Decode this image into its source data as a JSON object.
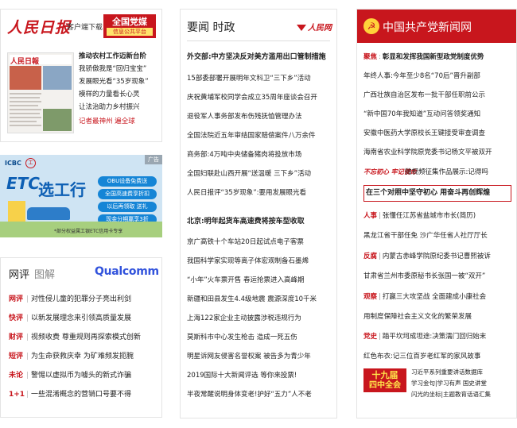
{
  "col1": {
    "masthead_logo": "人民日报",
    "client_download": "客户端下载",
    "badge_title": "全国党媒",
    "badge_sub": "信息公共平台",
    "thumb_masthead": "人民日報",
    "headlines": [
      {
        "text": "推动农村工作迈新台阶",
        "bold": true
      },
      {
        "text": "我骄傲我是“回归宝宝”"
      },
      {
        "text": "发展眼光看“35岁现象”"
      },
      {
        "text": "模样的力量看长心灵"
      },
      {
        "text": "让法治助力乡村振兴"
      },
      {
        "text": "记者最神州 遍全球",
        "red": true
      }
    ],
    "ad": {
      "brand": "ICBC",
      "brand_mark": "工",
      "tag": "广告",
      "etc": "ETC",
      "title": "选工行",
      "pills": [
        "OBU设备免费送",
        "全国高速费享折扣",
        "以后再领取 送礼",
        "现金分期赢享3折"
      ],
      "footer": "*部分权益属工银ETC信用卡专享"
    },
    "box": {
      "tab1": "网评",
      "tab2": "图解",
      "sponsor": "Qualcomm",
      "rows": [
        {
          "k": "网评",
          "text": "对性侵儿童的犯罪分子亮出利剑"
        },
        {
          "k": "快评",
          "text": "以新发展理念来引领高质量发展"
        },
        {
          "k": "财评",
          "text": "视频收费 尊重规则再探索模式创新"
        },
        {
          "k": "短评",
          "text": "为生命获救庆幸 为矿难频发扼腕"
        },
        {
          "k": "未论",
          "text": "警惕以虚拟币为噱头的新式诈骗"
        },
        {
          "k": "1+1",
          "text": "一些混淆概念的营销口号要不得"
        }
      ]
    }
  },
  "col2": {
    "title": "要闻",
    "title2": "时政",
    "logo": "人民网",
    "lead1": "外交部:中方坚决反对美方滥用出口管制措施",
    "items1": [
      "15部委部署开展明年文科卫“三下乡”活动",
      "庆祝黄埔军校同学会成立35周年座谈会召开",
      "退役军人事务部发布伤残抚恤管理办法",
      "全国法院近五年审结国家赔偿案件八万余件",
      "商务部:4万吨中央储备猪肉将投放市场",
      "全国妇联赴山西开展“送温暖 三下乡”活动",
      "人民日报评“35岁现象”:要用发展眼光看"
    ],
    "lead2": "北京:明年起货车高速费将按车型收取",
    "items2": [
      "京广高铁十个车站20日起试点电子客票",
      "我国科学家实现等离子体宏观制备石墨烯",
      "“小年”火车票开售 春运抢票进入高峰期",
      "新疆和田县发生4.4级地震 震源深度10千米",
      "上海122家企业主动披露涉税违规行为",
      "莫斯科市中心发生枪击 造成一死五伤",
      "明星诉网友侵害名誉权案 被告多为青少年",
      "2019国际十大新闻评选 等你来投票!",
      "半夜常醒说明身体变老!护好“五力”人不老"
    ]
  },
  "col3": {
    "title": "中国共产党新闻网",
    "emblem": "☭",
    "items": [
      {
        "tag": "聚焦",
        "text": "彰显和发挥我国新型政党制度优势",
        "bold": true
      },
      {
        "text": "年终人事:今年至少8名“70后”晋升副部"
      },
      {
        "text": "广西壮族自治区发布一批干部任职前公示"
      },
      {
        "text": "“新中国70年我知道”互动问答领奖通知"
      },
      {
        "text": "安徽中医药大学原校长王键接受审查调查"
      },
      {
        "text": "海南省农业科学院原党委书记杨文平被双开"
      },
      {
        "text": "微视频征集作品展示:记得吗"
      },
      {
        "text": "在三个对照中坚守初心 用奋斗再创辉煌",
        "bold": true,
        "boxed": true
      },
      {
        "tag": "人事",
        "text": "张懂任江苏省盐城市市长(简历)"
      },
      {
        "text": "黑龙江省干部任免 沙广华任省人社厅厅长"
      },
      {
        "tag": "反腐",
        "text": "内蒙古赤峰学院原纪委书记曹熙被诉"
      },
      {
        "text": "甘肃省兰州市委原秘书长张国一被“双开”"
      },
      {
        "tag": "观察",
        "text": "打赢三大攻坚战 全面建成小康社会"
      },
      {
        "text": "用制度保障社会主义文化的繁荣发展"
      },
      {
        "tag": "党史",
        "text": "踏平坎坷成坦途:决策濡门回归始末"
      },
      {
        "text": "红色布衣:记三位百岁老红军的家风故事"
      }
    ],
    "signature": "不忘初心 牢记使命",
    "quanhui": {
      "line1": "十九届",
      "line2": "四中全会"
    },
    "quanhui_links": [
      "习近平系列重要讲话数据库",
      "学习金句|学习有声 国史讲堂",
      "闪光的坐标|主题教育话语汇集"
    ]
  }
}
